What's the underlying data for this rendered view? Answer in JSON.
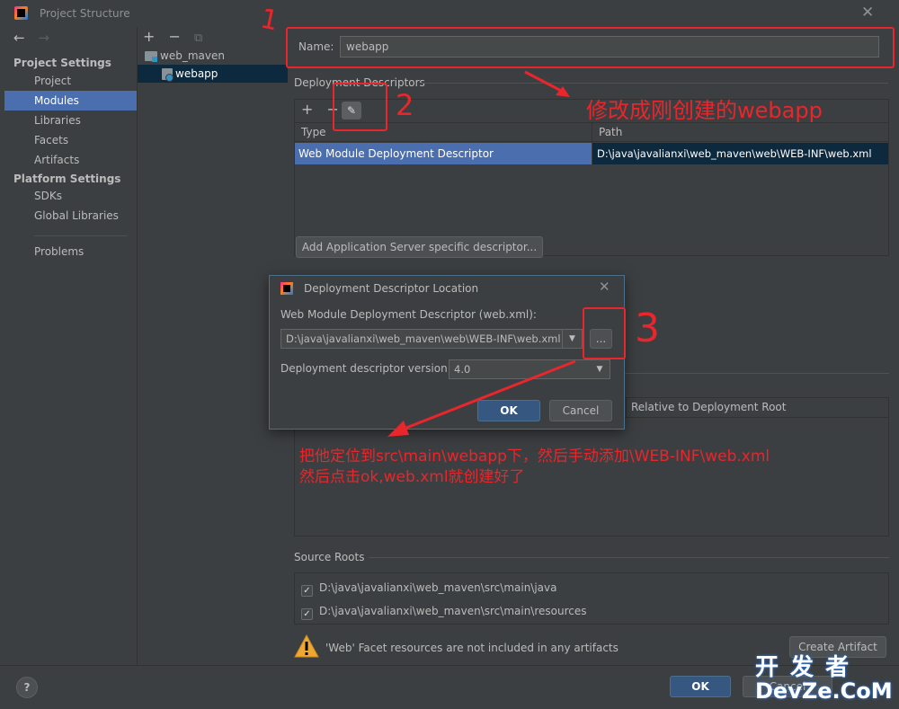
{
  "window": {
    "title": "Project Structure",
    "close": "✕"
  },
  "nav": {
    "back": "←",
    "forward": "→",
    "project_settings_header": "Project Settings",
    "project_settings": [
      "Project",
      "Modules",
      "Libraries",
      "Facets",
      "Artifacts"
    ],
    "platform_settings_header": "Platform Settings",
    "platform_settings": [
      "SDKs",
      "Global Libraries"
    ],
    "problems": "Problems",
    "selected": "Modules"
  },
  "tree": {
    "add": "+",
    "remove": "−",
    "copy": "⧉",
    "items": [
      {
        "label": "web_maven",
        "level": 0
      },
      {
        "label": "webapp",
        "level": 1,
        "selected": true
      }
    ]
  },
  "content": {
    "name_label": "Name:",
    "name_value": "webapp",
    "deployment_descriptors_title": "Deployment Descriptors",
    "dd_add": "+",
    "dd_remove": "−",
    "dd_edit": "✎",
    "columns": [
      "Type",
      "Path"
    ],
    "row": {
      "type": "Web Module Deployment Descriptor",
      "path": "D:\\java\\javalianxi\\web_maven\\web\\WEB-INF\\web.xml"
    },
    "add_server_button": "Add Application Server specific descriptor...",
    "relative_column": "Relative to Deployment Root",
    "source_roots_title": "Source Roots",
    "source_roots": [
      "D:\\java\\javalianxi\\web_maven\\src\\main\\java",
      "D:\\java\\javalianxi\\web_maven\\src\\main\\resources"
    ],
    "warning_text": "'Web' Facet resources are not included in any artifacts",
    "create_artifact_button": "Create Artifact"
  },
  "dialog": {
    "title": "Deployment Descriptor Location",
    "close": "✕",
    "descriptor_label": "Web Module Deployment Descriptor (web.xml):",
    "descriptor_path": "D:\\java\\javalianxi\\web_maven\\web\\WEB-INF\\web.xml",
    "browse": "...",
    "version_label": "Deployment descriptor version",
    "version_value": "4.0",
    "ok": "OK",
    "cancel": "Cancel"
  },
  "bottom": {
    "help": "?",
    "ok": "OK",
    "cancel": "Cancel"
  },
  "annotations": {
    "num1": "1",
    "num2": "2",
    "num3": "3",
    "note_name": "修改成刚创建的webapp",
    "note_locate_1": "把他定位到src\\main\\webapp下，然后手动添加\\WEB-INF\\web.xml",
    "note_locate_2": "然后点击ok,web.xml就创建好了",
    "color": "#e8262b"
  },
  "watermark": {
    "line1": "开 发 者",
    "line2": "DevZe.CoM"
  },
  "colors": {
    "background": "#3c3f41",
    "selection": "#4b6eaf",
    "path_selection": "#0d293e",
    "default_button": "#365880"
  }
}
